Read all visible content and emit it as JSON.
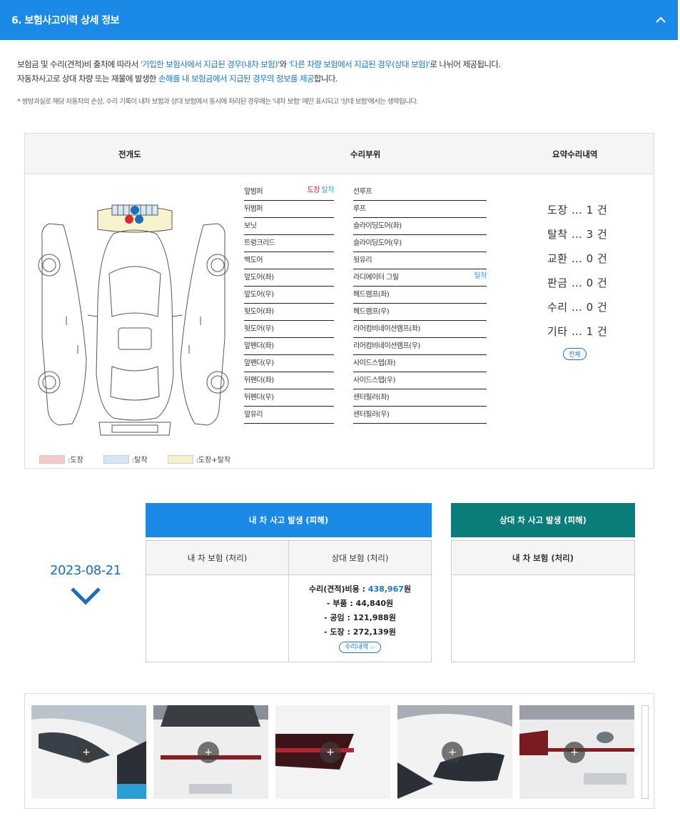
{
  "header": {
    "title": "6. 보험사고이력 상세 정보"
  },
  "intro": {
    "line1_a": "보험금 및 수리(견적)비 출처에 따라서 ",
    "line1_hl1": "'가입한 보험사에서 지급된 경우(내차 보험)'",
    "line1_b": "와 ",
    "line1_hl2": "'다른 차량 보험에서 지급된 경우(상대 보험)'",
    "line1_c": "로 나뉘어 제공됩니다.",
    "line2_a": "자동차사고로 상대 차량 또는 재물에 발생한 ",
    "line2_hl": "손해를 내 보험금에서 지급된 경우의 정보를 제공",
    "line2_b": "합니다.",
    "note": "* 쌍방과실로 해당 자동차의 손상, 수리 기록이 내차 보험과 상대 보험에서 동시에 처리된 경우에는 '내차 보험' 에만 표시되고 '상대 보험'에서는 생략됩니다."
  },
  "diagram_table": {
    "headers": {
      "diagram": "전개도",
      "parts": "수리부위",
      "summary": "요약수리내역"
    },
    "parts_left": [
      {
        "label": "앞범퍼",
        "tag1": "도장",
        "tag2": "탈착"
      },
      {
        "label": "뒤범퍼"
      },
      {
        "label": "보닛"
      },
      {
        "label": "트렁크리드"
      },
      {
        "label": "백도어"
      },
      {
        "label": "앞도어(좌)"
      },
      {
        "label": "앞도어(우)"
      },
      {
        "label": "뒷도어(좌)"
      },
      {
        "label": "뒷도어(우)"
      },
      {
        "label": "앞펜더(좌)"
      },
      {
        "label": "앞펜더(우)"
      },
      {
        "label": "뒤펜더(좌)"
      },
      {
        "label": "뒤펜더(우)"
      },
      {
        "label": "앞유리"
      }
    ],
    "parts_right": [
      {
        "label": "선루프"
      },
      {
        "label": "루프"
      },
      {
        "label": "슬라이딩도어(좌)"
      },
      {
        "label": "슬라이딩도어(우)"
      },
      {
        "label": "뒷유리"
      },
      {
        "label": "라디에이터 그릴",
        "tag2": "탈착"
      },
      {
        "label": "헤드램프(좌)"
      },
      {
        "label": "헤드램프(우)"
      },
      {
        "label": "리어컴비네이션램프(좌)"
      },
      {
        "label": "리어컴비네이션램프(우)"
      },
      {
        "label": "사이드스텝(좌)"
      },
      {
        "label": "사이드스텝(우)"
      },
      {
        "label": "센터필러(좌)"
      },
      {
        "label": "센터필러(우)"
      }
    ],
    "summary": [
      "도장 … 1 건",
      "탈착 … 3 건",
      "교환 … 0 건",
      "판금 … 0 건",
      "수리 … 0 건",
      "기타 … 1 건"
    ],
    "summary_button": "전체",
    "legend": [
      {
        "label": ":도장",
        "color": "#f7c9c9"
      },
      {
        "label": ":탈착",
        "color": "#d6e6f7"
      },
      {
        "label": ":도장+탈착",
        "color": "#f7f3cf"
      }
    ]
  },
  "accident": {
    "date": "2023-08-21",
    "my_car_header": "내 차 사고 발생 (피해)",
    "other_car_header": "상대 차 사고 발생 (피해)",
    "col_my_insurance": "내 차 보험 (처리)",
    "col_other_insurance": "상대 보험 (처리)",
    "col_my_insurance_2": "내 차 보험 (처리)",
    "cost_label": "수리(견적)비용 : ",
    "cost_amount": "438,967",
    "cost_unit": "원",
    "parts_cost": "- 부품 : 44,840원",
    "labor_cost": "- 공임 : 121,988원",
    "paint_cost": "- 도장 : 272,139원",
    "detail_button": "수리내역 ⌵"
  },
  "photos": {
    "count": 5,
    "plus_label": "+"
  }
}
